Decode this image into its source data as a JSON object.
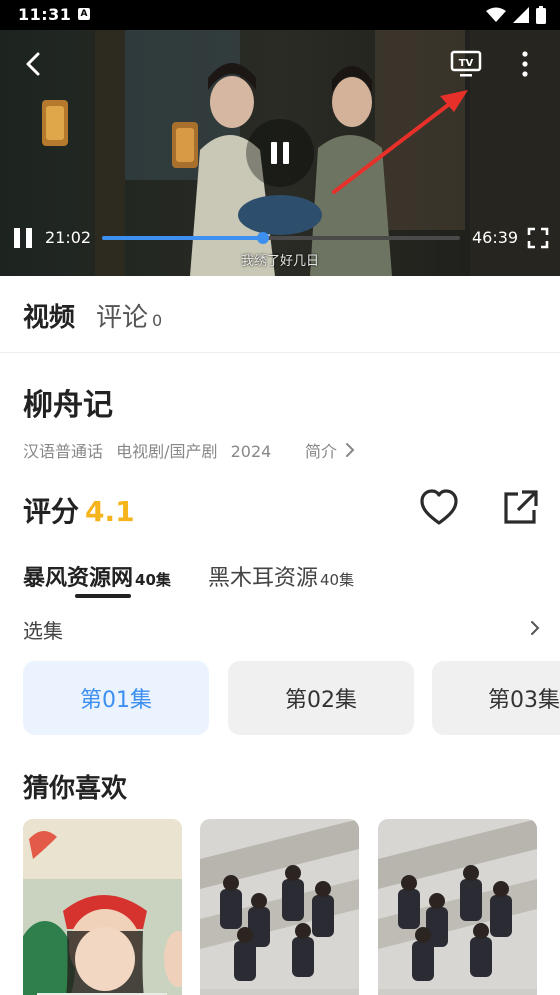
{
  "status_bar": {
    "time": "11:31",
    "notification_icon_letter": "A"
  },
  "player": {
    "current_time": "21:02",
    "total_time": "46:39",
    "progress_fraction": 0.45,
    "subtitle": "我绣了好几日",
    "accent_color": "#3d8ff0"
  },
  "tabs": {
    "video": "视频",
    "comment": "评论",
    "comment_count": "0"
  },
  "show": {
    "title": "柳舟记",
    "meta": [
      "汉语普通话",
      "电视剧/国产剧",
      "2024"
    ],
    "intro_label": "简介"
  },
  "rating": {
    "label": "评分",
    "value": "4.1",
    "color": "#f5b41c"
  },
  "sources": [
    {
      "name": "暴风资源网",
      "count": "40集",
      "active": true
    },
    {
      "name": "黑木耳资源",
      "count": "40集",
      "active": false
    }
  ],
  "episode_select": {
    "label": "选集"
  },
  "episodes": [
    {
      "label": "第01集",
      "active": true
    },
    {
      "label": "第02集",
      "active": false
    },
    {
      "label": "第03集",
      "active": false
    }
  ],
  "recommend": {
    "title": "猜你喜欢"
  }
}
